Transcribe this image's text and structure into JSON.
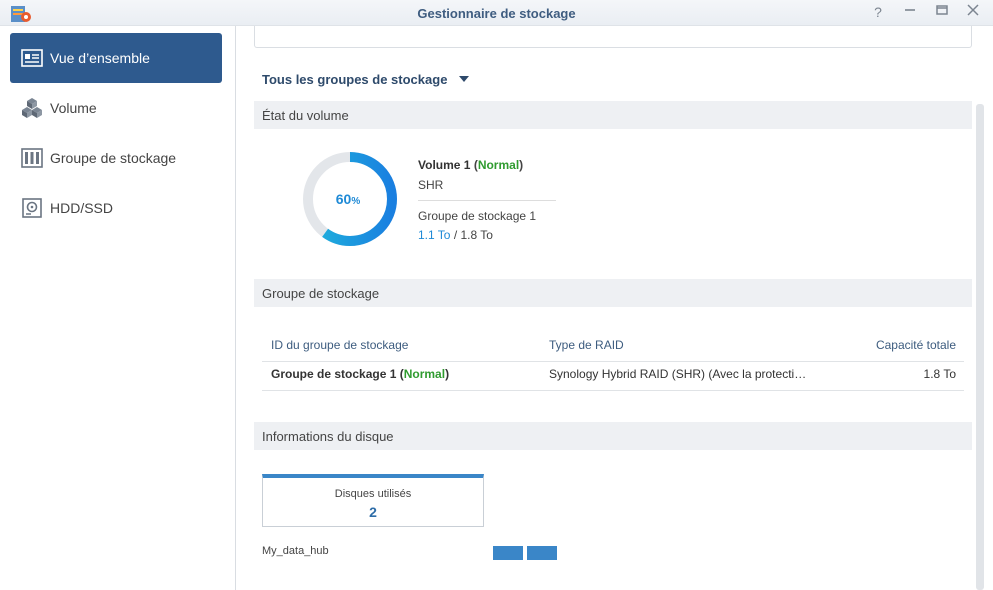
{
  "window": {
    "title": "Gestionnaire de stockage",
    "buttons": [
      "help",
      "minimize",
      "maximize",
      "close"
    ]
  },
  "sidebar": {
    "items": [
      {
        "label": "Vue d’ensemble",
        "icon": "overview-icon",
        "active": true
      },
      {
        "label": "Volume",
        "icon": "cubes-icon"
      },
      {
        "label": "Groupe de stockage",
        "icon": "storage-pool-icon"
      },
      {
        "label": "HDD/SSD",
        "icon": "disk-icon"
      }
    ]
  },
  "main": {
    "group_selector": "Tous les groupes de stockage",
    "volume_section": {
      "heading": "État du volume",
      "usage_percent": "60",
      "usage_fraction": 0.6,
      "percent_sign": "%",
      "volume_name": "Volume 1",
      "volume_status": "Normal",
      "raid": "SHR",
      "pool": "Groupe de stockage 1",
      "used": "1.1 To",
      "total": "1.8 To"
    },
    "pool_section": {
      "heading": "Groupe de stockage",
      "columns": [
        "ID du groupe de stockage",
        "Type de RAID",
        "Capacité totale"
      ],
      "rows": [
        {
          "name": "Groupe de stockage 1",
          "status": "Normal",
          "raid": "Synology Hybrid RAID (SHR) (Avec la protecti…",
          "capacity": "1.8 To"
        }
      ]
    },
    "disk_section": {
      "heading": "Informations du disque",
      "used_label": "Disques utilisés",
      "used_count": "2",
      "device_name": "My_data_hub"
    }
  },
  "colors": {
    "accent": "#2e5a8e",
    "chart_blue": "#1f8ad6",
    "status_green": "#2f9b2f"
  }
}
